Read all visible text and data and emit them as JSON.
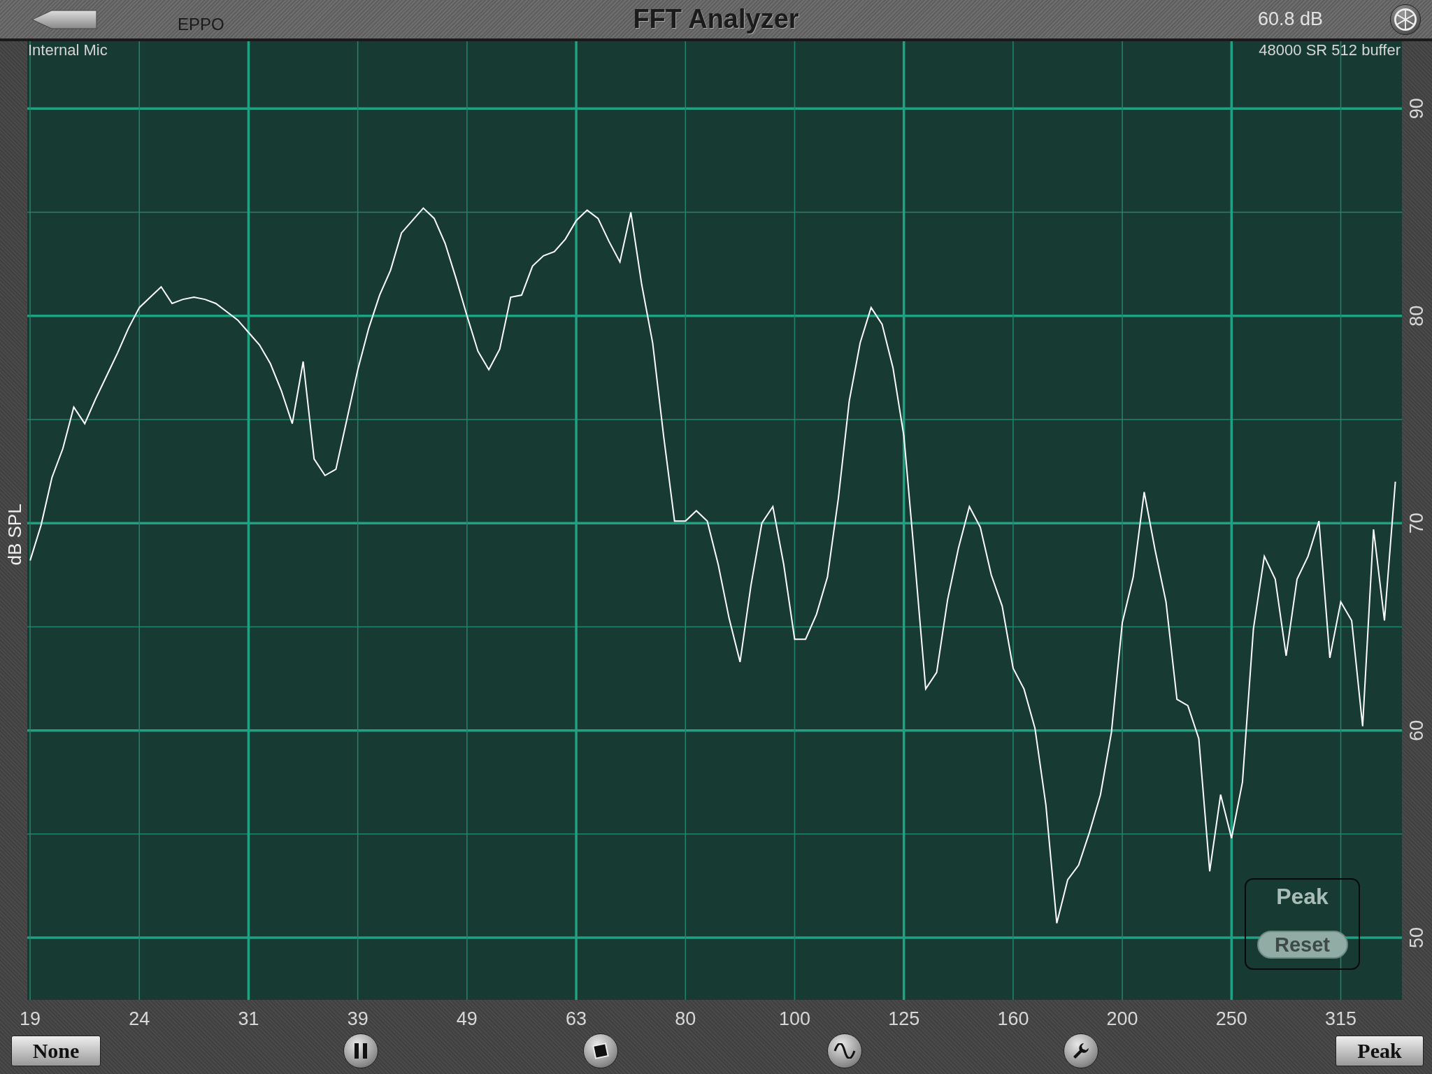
{
  "toolbar": {
    "source": "EPPO",
    "title": "FFT Analyzer",
    "reading": "60.8 dB"
  },
  "analyzer": {
    "input_label": "Internal Mic",
    "buffer_info": "48000 SR 512 buffer",
    "chart_data": {
      "type": "line",
      "grid": true,
      "ylabel": "dB SPL",
      "ylim": [
        47,
        93.25
      ],
      "yticks": [
        50,
        60,
        70,
        80,
        90
      ],
      "categories": [
        "19",
        null,
        null,
        null,
        null,
        null,
        null,
        null,
        null,
        null,
        "24",
        null,
        null,
        null,
        null,
        null,
        null,
        null,
        null,
        null,
        "31",
        null,
        null,
        null,
        null,
        null,
        null,
        null,
        null,
        null,
        "39",
        null,
        null,
        null,
        null,
        null,
        null,
        null,
        null,
        null,
        "49",
        null,
        null,
        null,
        null,
        null,
        null,
        null,
        null,
        null,
        "63",
        null,
        null,
        null,
        null,
        null,
        null,
        null,
        null,
        null,
        "80",
        null,
        null,
        null,
        null,
        null,
        null,
        null,
        null,
        null,
        "100",
        null,
        null,
        null,
        null,
        null,
        null,
        null,
        null,
        null,
        "125",
        null,
        null,
        null,
        null,
        null,
        null,
        null,
        null,
        null,
        "160",
        null,
        null,
        null,
        null,
        null,
        null,
        null,
        null,
        null,
        "200",
        null,
        null,
        null,
        null,
        null,
        null,
        null,
        null,
        null,
        "250",
        null,
        null,
        null,
        null,
        null,
        null,
        null,
        null,
        null,
        "315",
        null,
        null,
        null,
        null,
        null
      ],
      "series": [
        {
          "color": "#ffffff",
          "values": [
            68.2,
            69.9,
            72.2,
            73.6,
            75.6,
            74.8,
            76.0,
            77.1,
            78.2,
            79.4,
            80.4,
            80.9,
            81.4,
            80.6,
            80.8,
            80.9,
            80.8,
            80.6,
            80.2,
            79.8,
            79.2,
            78.6,
            77.7,
            76.4,
            74.8,
            77.8,
            73.1,
            72.3,
            72.6,
            75.0,
            77.4,
            79.4,
            81.0,
            82.2,
            84.0,
            84.6,
            85.2,
            84.7,
            83.5,
            81.8,
            80.0,
            78.3,
            77.4,
            78.4,
            80.9,
            81.0,
            82.4,
            82.9,
            83.1,
            83.7,
            84.6,
            85.1,
            84.7,
            83.6,
            82.6,
            85.0,
            81.5,
            78.7,
            74.2,
            70.1,
            70.1,
            70.6,
            70.1,
            68.0,
            65.4,
            63.3,
            67.0,
            70.0,
            70.8,
            68.0,
            64.4,
            64.4,
            65.6,
            67.4,
            71.2,
            75.9,
            78.7,
            80.4,
            79.6,
            77.5,
            74.2,
            68.2,
            62.0,
            62.8,
            66.3,
            68.8,
            70.8,
            69.8,
            67.5,
            66.0,
            63.0,
            62.0,
            60.1,
            56.4,
            50.7,
            52.8,
            53.5,
            55.1,
            56.9,
            59.9,
            65.2,
            67.4,
            71.5,
            68.7,
            66.2,
            61.5,
            61.2,
            59.6,
            53.2,
            56.9,
            54.8,
            57.5,
            64.9,
            68.4,
            67.3,
            63.6,
            67.3,
            68.4,
            70.1,
            63.5,
            66.2,
            65.3,
            60.2,
            69.7,
            65.3,
            72.0
          ]
        }
      ]
    },
    "peak_panel": {
      "title": "Peak",
      "reset_button": "Reset"
    }
  },
  "bottom_bar": {
    "left_button": "None",
    "right_button": "Peak"
  }
}
